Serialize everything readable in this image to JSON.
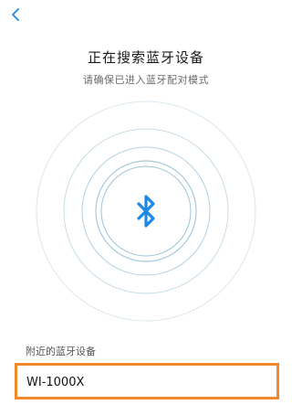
{
  "header": {
    "back_icon": "chevron-left-icon"
  },
  "main": {
    "title": "正在搜索蓝牙设备",
    "subtitle": "请确保已进入蓝牙配对模式",
    "center_icon": "bluetooth-icon",
    "accent_color": "#1e88e5"
  },
  "devices": {
    "section_label": "附近的蓝牙设备",
    "items": [
      {
        "name": "WI-1000X"
      }
    ],
    "highlight_color": "#f08a2c"
  }
}
